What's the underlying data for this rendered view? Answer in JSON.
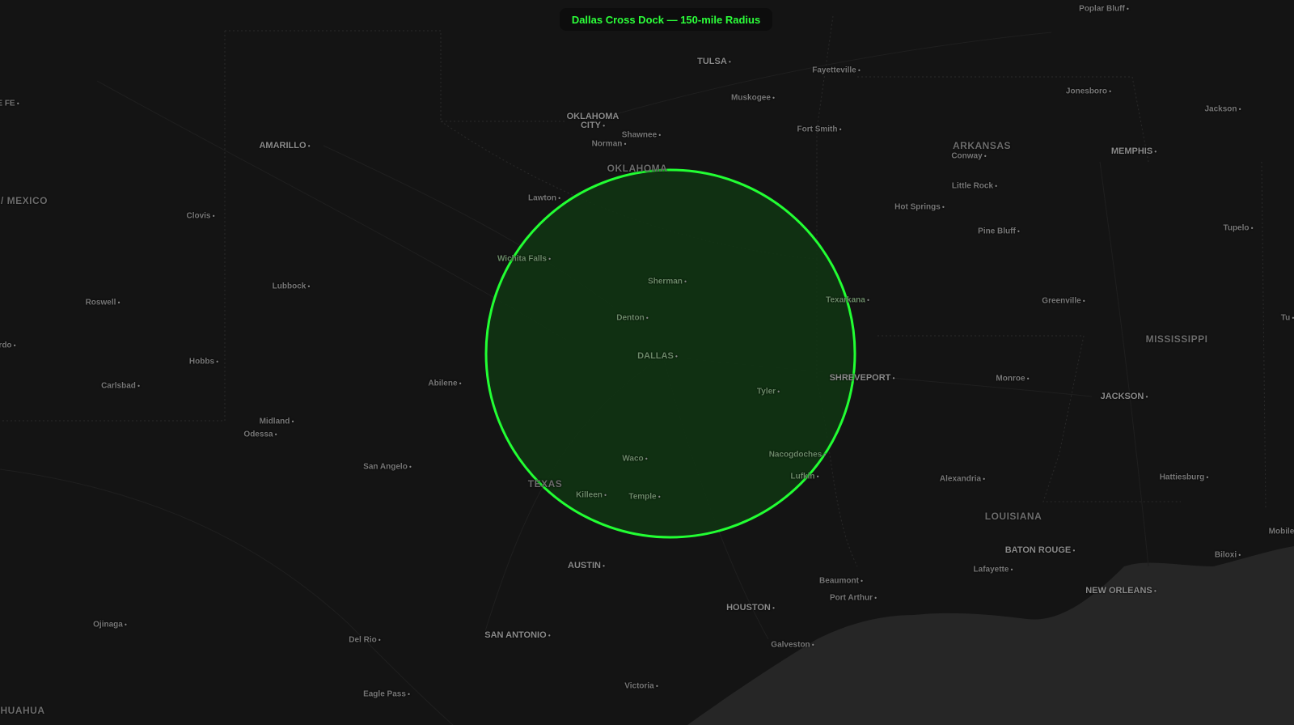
{
  "title": "Dallas Cross Dock — 150-mile Radius",
  "colors": {
    "background": "#111111",
    "land": "#151515",
    "water": "#262626",
    "radius_stroke": "#22ff33",
    "radius_fill": "#0f3512",
    "title_text": "#2cff3a"
  },
  "states": [
    {
      "name": "OKLAHOMA"
    },
    {
      "name": "ARKANSAS"
    },
    {
      "name": "TEXAS"
    },
    {
      "name": "LOUISIANA"
    },
    {
      "name": "MISSISSIPPI"
    },
    {
      "name": "/ MEXICO"
    },
    {
      "name": "HUAHUA"
    }
  ],
  "cities": [
    {
      "name": "Poplar Bluff"
    },
    {
      "name": "TULSA"
    },
    {
      "name": "Fayetteville"
    },
    {
      "name": "Muskogee"
    },
    {
      "name": "Jonesboro"
    },
    {
      "name": "Jackson"
    },
    {
      "name": "E FE"
    },
    {
      "name": "OKLAHOMA CITY"
    },
    {
      "name": "Fort Smith"
    },
    {
      "name": "AMARILLO"
    },
    {
      "name": "Shawnee"
    },
    {
      "name": "Norman"
    },
    {
      "name": "Conway"
    },
    {
      "name": "MEMPHIS"
    },
    {
      "name": "Little Rock"
    },
    {
      "name": "Lawton"
    },
    {
      "name": "Hot Springs"
    },
    {
      "name": "Clovis"
    },
    {
      "name": "Tupelo"
    },
    {
      "name": "Pine Bluff"
    },
    {
      "name": "Wichita Falls"
    },
    {
      "name": "Lubbock"
    },
    {
      "name": "Sherman"
    },
    {
      "name": "Roswell"
    },
    {
      "name": "Texarkana"
    },
    {
      "name": "Greenville"
    },
    {
      "name": "Denton"
    },
    {
      "name": "Tu"
    },
    {
      "name": "rdo"
    },
    {
      "name": "DALLAS"
    },
    {
      "name": "Hobbs"
    },
    {
      "name": "SHREVEPORT"
    },
    {
      "name": "Monroe"
    },
    {
      "name": "Carlsbad"
    },
    {
      "name": "Abilene"
    },
    {
      "name": "Tyler"
    },
    {
      "name": "JACKSON"
    },
    {
      "name": "Midland"
    },
    {
      "name": "Odessa"
    },
    {
      "name": "Nacogdoches"
    },
    {
      "name": "San Angelo"
    },
    {
      "name": "Waco"
    },
    {
      "name": "Lufkin"
    },
    {
      "name": "Alexandria"
    },
    {
      "name": "Hattiesburg"
    },
    {
      "name": "Killeen"
    },
    {
      "name": "Temple"
    },
    {
      "name": "Mobile"
    },
    {
      "name": "BATON ROUGE"
    },
    {
      "name": "Biloxi"
    },
    {
      "name": "AUSTIN"
    },
    {
      "name": "Lafayette"
    },
    {
      "name": "Beaumont"
    },
    {
      "name": "NEW ORLEANS"
    },
    {
      "name": "Port Arthur"
    },
    {
      "name": "HOUSTON"
    },
    {
      "name": "Ojinaga"
    },
    {
      "name": "SAN ANTONIO"
    },
    {
      "name": "Del Rio"
    },
    {
      "name": "Galveston"
    },
    {
      "name": "Victoria"
    },
    {
      "name": "Eagle Pass"
    }
  ]
}
